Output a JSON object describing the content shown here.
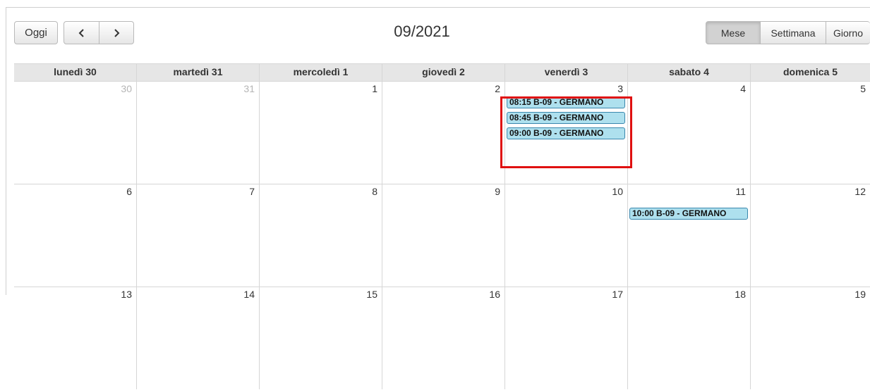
{
  "toolbar": {
    "today_label": "Oggi",
    "prev_icon": "chevron-left-icon",
    "next_icon": "chevron-right-icon",
    "title": "09/2021",
    "views": [
      {
        "label": "Mese",
        "active": true
      },
      {
        "label": "Settimana",
        "active": false
      },
      {
        "label": "Giorno",
        "active": false
      }
    ]
  },
  "weekdays": [
    "lunedì 30",
    "martedì 31",
    "mercoledì 1",
    "giovedì 2",
    "venerdì 3",
    "sabato 4",
    "domenica 5"
  ],
  "weeks": [
    {
      "days": [
        {
          "num": "30",
          "other_month": true,
          "events": []
        },
        {
          "num": "31",
          "other_month": true,
          "events": []
        },
        {
          "num": "1",
          "other_month": false,
          "events": []
        },
        {
          "num": "2",
          "other_month": false,
          "events": []
        },
        {
          "num": "3",
          "other_month": false,
          "events": [
            "08:15 B-09 - GERMANO",
            "08:45 B-09 - GERMANO",
            "09:00 B-09 - GERMANO"
          ]
        },
        {
          "num": "4",
          "other_month": false,
          "events": []
        },
        {
          "num": "5",
          "other_month": false,
          "events": []
        }
      ]
    },
    {
      "days": [
        {
          "num": "6",
          "other_month": false,
          "events": []
        },
        {
          "num": "7",
          "other_month": false,
          "events": []
        },
        {
          "num": "8",
          "other_month": false,
          "events": []
        },
        {
          "num": "9",
          "other_month": false,
          "events": []
        },
        {
          "num": "10",
          "other_month": false,
          "events": []
        },
        {
          "num": "11",
          "other_month": false,
          "events": [
            "10:00 B-09 - GERMANO"
          ]
        },
        {
          "num": "12",
          "other_month": false,
          "events": []
        }
      ]
    },
    {
      "days": [
        {
          "num": "13",
          "other_month": false,
          "events": []
        },
        {
          "num": "14",
          "other_month": false,
          "events": []
        },
        {
          "num": "15",
          "other_month": false,
          "events": []
        },
        {
          "num": "16",
          "other_month": false,
          "events": []
        },
        {
          "num": "17",
          "other_month": false,
          "events": []
        },
        {
          "num": "18",
          "other_month": false,
          "events": []
        },
        {
          "num": "19",
          "other_month": false,
          "events": []
        }
      ]
    }
  ],
  "colors": {
    "event_bg": "#aee0ee",
    "event_border": "#3a87ad",
    "highlight": "#e01010",
    "header_bg": "#e6e6e6"
  }
}
